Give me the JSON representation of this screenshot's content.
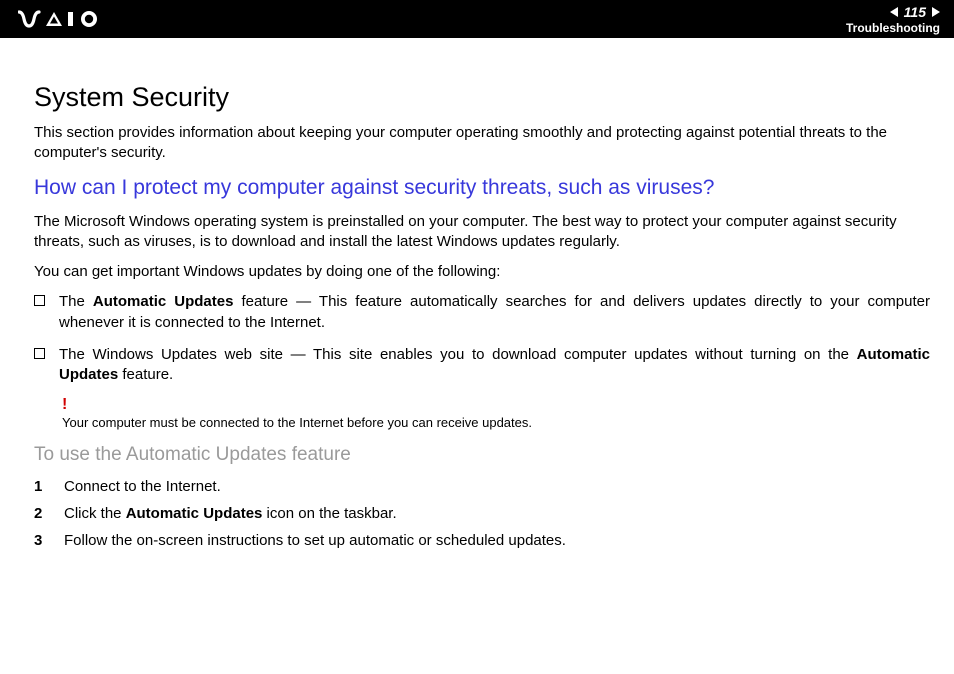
{
  "header": {
    "page_number": "115",
    "section_label": "Troubleshooting"
  },
  "content": {
    "title": "System Security",
    "intro": "This section provides information about keeping your computer operating smoothly and protecting against potential threats to the computer's security.",
    "question": "How can I protect my computer against security threats, such as viruses?",
    "para1": "The Microsoft Windows operating system is preinstalled on your computer. The best way to protect your computer against security threats, such as viruses, is to download and install the latest Windows updates regularly.",
    "para2": "You can get important Windows updates by doing one of the following:",
    "bullets": [
      {
        "prefix": "The ",
        "bold1": "Automatic Updates",
        "mid": " feature — This feature automatically searches for and delivers updates directly to your computer whenever it is connected to the Internet.",
        "bold2": "",
        "suffix": ""
      },
      {
        "prefix": "The Windows Updates web site — This site enables you to download computer updates without turning on the ",
        "bold1": "Automatic Updates",
        "mid": " feature.",
        "bold2": "",
        "suffix": ""
      }
    ],
    "note_mark": "!",
    "note_text": "Your computer must be connected to the Internet before you can receive updates.",
    "subhead": "To use the Automatic Updates feature",
    "steps": [
      {
        "num": "1",
        "prefix": "Connect to the Internet.",
        "bold": "",
        "suffix": ""
      },
      {
        "num": "2",
        "prefix": "Click the ",
        "bold": "Automatic Updates",
        "suffix": " icon on the taskbar."
      },
      {
        "num": "3",
        "prefix": "Follow the on-screen instructions to set up automatic or scheduled updates.",
        "bold": "",
        "suffix": ""
      }
    ]
  }
}
